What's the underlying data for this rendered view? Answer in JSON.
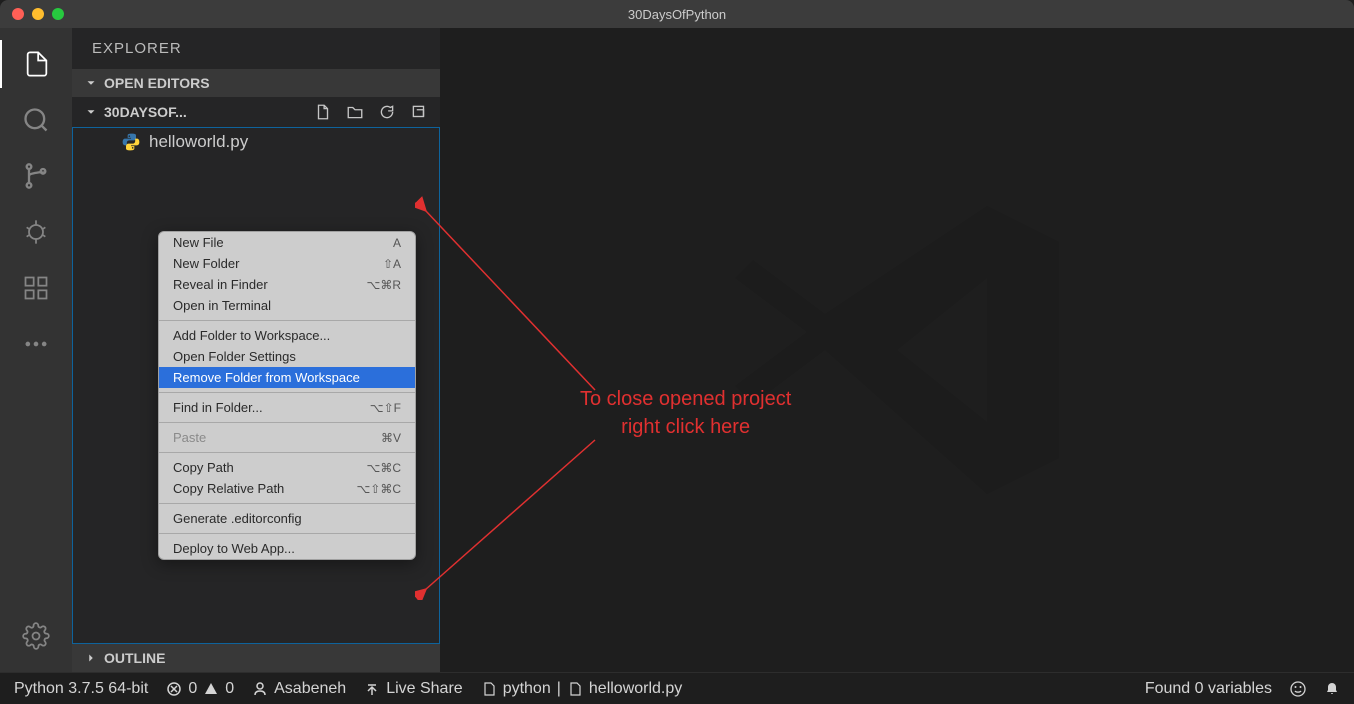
{
  "titlebar": {
    "title": "30DaysOfPython"
  },
  "sidebar": {
    "title": "EXPLORER",
    "open_editors": "OPEN EDITORS",
    "folder_name": "30DAYSOF...",
    "outline": "OUTLINE",
    "files": [
      {
        "name": "helloworld.py"
      }
    ]
  },
  "context_menu": {
    "items": [
      {
        "label": "New File",
        "shortcut": "A"
      },
      {
        "label": "New Folder",
        "shortcut": "⇧A"
      },
      {
        "label": "Reveal in Finder",
        "shortcut": "⌥⌘R"
      },
      {
        "label": "Open in Terminal",
        "shortcut": ""
      }
    ],
    "items2": [
      {
        "label": "Add Folder to Workspace...",
        "shortcut": ""
      },
      {
        "label": "Open Folder Settings",
        "shortcut": ""
      },
      {
        "label": "Remove Folder from Workspace",
        "shortcut": "",
        "highlighted": true
      }
    ],
    "items3": [
      {
        "label": "Find in Folder...",
        "shortcut": "⌥⇧F"
      }
    ],
    "items4": [
      {
        "label": "Paste",
        "shortcut": "⌘V",
        "disabled": true
      }
    ],
    "items5": [
      {
        "label": "Copy Path",
        "shortcut": "⌥⌘C"
      },
      {
        "label": "Copy Relative Path",
        "shortcut": "⌥⇧⌘C"
      }
    ],
    "items6": [
      {
        "label": "Generate .editorconfig",
        "shortcut": ""
      }
    ],
    "items7": [
      {
        "label": "Deploy to Web App...",
        "shortcut": ""
      }
    ]
  },
  "annotation": {
    "line1": "To close opened project",
    "line2": "right click here"
  },
  "statusbar": {
    "python": "Python 3.7.5 64-bit",
    "errors": "0",
    "warnings": "0",
    "user": "Asabeneh",
    "liveshare": "Live Share",
    "pythonlang": "python",
    "file": "helloworld.py",
    "variables": "Found 0 variables"
  }
}
